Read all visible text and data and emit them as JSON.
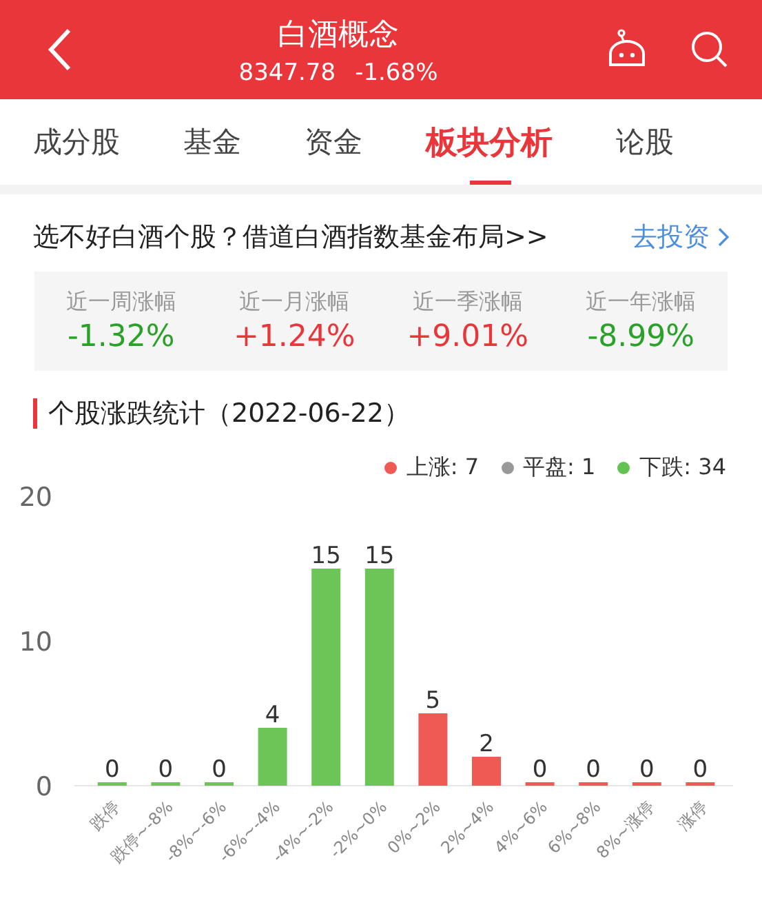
{
  "header": {
    "title": "白酒概念",
    "price": "8347.78",
    "change": "-1.68%"
  },
  "tabs": [
    {
      "label": "成分股",
      "selected": false
    },
    {
      "label": "基金",
      "selected": false
    },
    {
      "label": "资金",
      "selected": false
    },
    {
      "label": "板块分析",
      "selected": true
    },
    {
      "label": "论股",
      "selected": false
    }
  ],
  "promo": {
    "text": "选不好白酒个股？借道白酒指数基金布局>>",
    "link": "去投资"
  },
  "performance": [
    {
      "label": "近一周涨幅",
      "value": "-1.32%",
      "color": "#2aa22a"
    },
    {
      "label": "近一月涨幅",
      "value": "+1.24%",
      "color": "#e8363a"
    },
    {
      "label": "近一季涨幅",
      "value": "+9.01%",
      "color": "#e8363a"
    },
    {
      "label": "近一年涨幅",
      "value": "-8.99%",
      "color": "#2aa22a"
    }
  ],
  "section_title": "个股涨跌统计（2022-06-22）",
  "legend": [
    {
      "label": "上涨: 7",
      "color": "#ef5a55"
    },
    {
      "label": "平盘: 1",
      "color": "#999999"
    },
    {
      "label": "下跌: 34",
      "color": "#62c252"
    }
  ],
  "chart_data": {
    "type": "bar",
    "categories": [
      "跌停",
      "跌停~-8%",
      "-8%~-6%",
      "-6%~-4%",
      "-4%~-2%",
      "-2%~0%",
      "0%~2%",
      "2%~4%",
      "4%~6%",
      "6%~8%",
      "8%~涨停",
      "涨停"
    ],
    "series": [
      {
        "color": "#6cc556",
        "values": [
          0,
          0,
          0,
          4,
          15,
          15,
          null,
          null,
          null,
          null,
          null,
          null
        ]
      },
      {
        "color": "#ef5a55",
        "values": [
          null,
          null,
          null,
          null,
          null,
          null,
          5,
          2,
          0,
          0,
          0,
          0
        ]
      }
    ],
    "ylim": [
      0,
      20
    ],
    "yticks": [
      0,
      10,
      20
    ],
    "data_labels": true
  }
}
